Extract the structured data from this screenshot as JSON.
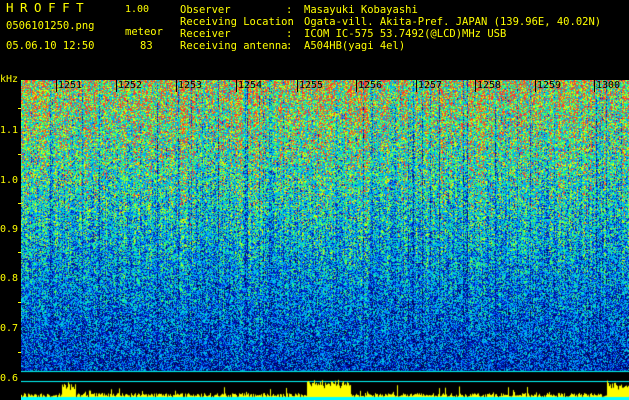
{
  "header": {
    "app_title": "HROFFT",
    "app_version": "1.00",
    "file_name": "0506101250.png",
    "datetime": "05.06.10 12:50",
    "meteor_label": "meteor",
    "meteor_count": "83"
  },
  "info": [
    {
      "key": "Observer",
      "value": "Masayuki Kobayashi"
    },
    {
      "key": "Receiving Location",
      "value": "Ogata-vill. Akita-Pref. JAPAN (139.96E, 40.02N)"
    },
    {
      "key": "Receiver",
      "value": "ICOM IC-575 53.7492(@LCD)MHz USB"
    },
    {
      "key": "Receiving antenna",
      "value": "A504HB(yagi 4el)"
    }
  ],
  "info_separator": ":",
  "axis": {
    "unit": "kHz",
    "y_ticks": [
      "1.1",
      "1.0",
      "0.9",
      "0.8",
      "0.7",
      "0.6"
    ],
    "time_ticks": [
      "1251",
      "1252",
      "1253",
      "1254",
      "1255",
      "1256",
      "1257",
      "1258",
      "1259",
      "1300"
    ]
  },
  "colors": {
    "text": "#ffff00",
    "background": "#000000",
    "level_bar": "#ffff00",
    "baseline": "#00ffff"
  }
}
